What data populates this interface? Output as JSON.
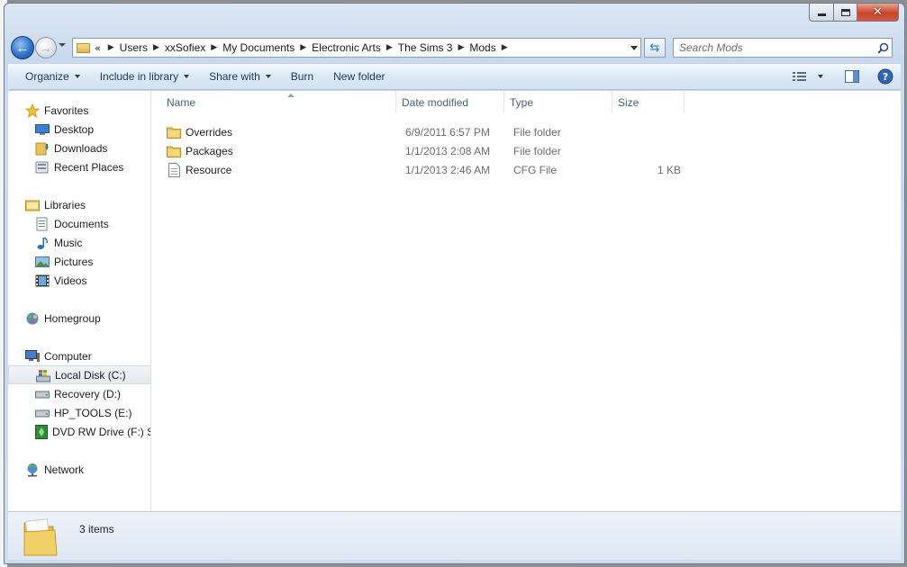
{
  "window": {
    "caption": {
      "minimize": "minimize",
      "maximize": "maximize",
      "close": "close"
    }
  },
  "address_bar": {
    "overflow": "«",
    "breadcrumbs": [
      "Users",
      "xxSofiex",
      "My Documents",
      "Electronic Arts",
      "The Sims 3",
      "Mods"
    ]
  },
  "search": {
    "placeholder": "Search Mods"
  },
  "command_bar": {
    "organize": "Organize",
    "include_in_library": "Include in library",
    "share_with": "Share with",
    "burn": "Burn",
    "new_folder": "New folder"
  },
  "nav_pane": {
    "favorites": {
      "label": "Favorites",
      "items": [
        "Desktop",
        "Downloads",
        "Recent Places"
      ]
    },
    "libraries": {
      "label": "Libraries",
      "items": [
        "Documents",
        "Music",
        "Pictures",
        "Videos"
      ]
    },
    "homegroup": {
      "label": "Homegroup"
    },
    "computer": {
      "label": "Computer",
      "items": [
        "Local Disk (C:)",
        "Recovery (D:)",
        "HP_TOOLS (E:)",
        "DVD RW Drive (F:) Si"
      ]
    },
    "network": {
      "label": "Network"
    }
  },
  "file_list": {
    "columns": {
      "name": "Name",
      "date_modified": "Date modified",
      "type": "Type",
      "size": "Size"
    },
    "rows": [
      {
        "name": "Overrides",
        "date": "6/9/2011 6:57 PM",
        "type": "File folder",
        "size": "",
        "icon": "folder-icon"
      },
      {
        "name": "Packages",
        "date": "1/1/2013 2:08 AM",
        "type": "File folder",
        "size": "",
        "icon": "folder-icon"
      },
      {
        "name": "Resource",
        "date": "1/1/2013 2:46 AM",
        "type": "CFG File",
        "size": "1 KB",
        "icon": "cfg-file-icon"
      }
    ]
  },
  "details_pane": {
    "item_count": "3 items"
  },
  "colors": {
    "command_text": "#1e395b",
    "header_text": "#4c607a",
    "secondary_text": "#6d6d6d",
    "folder": "#e8c25a"
  }
}
